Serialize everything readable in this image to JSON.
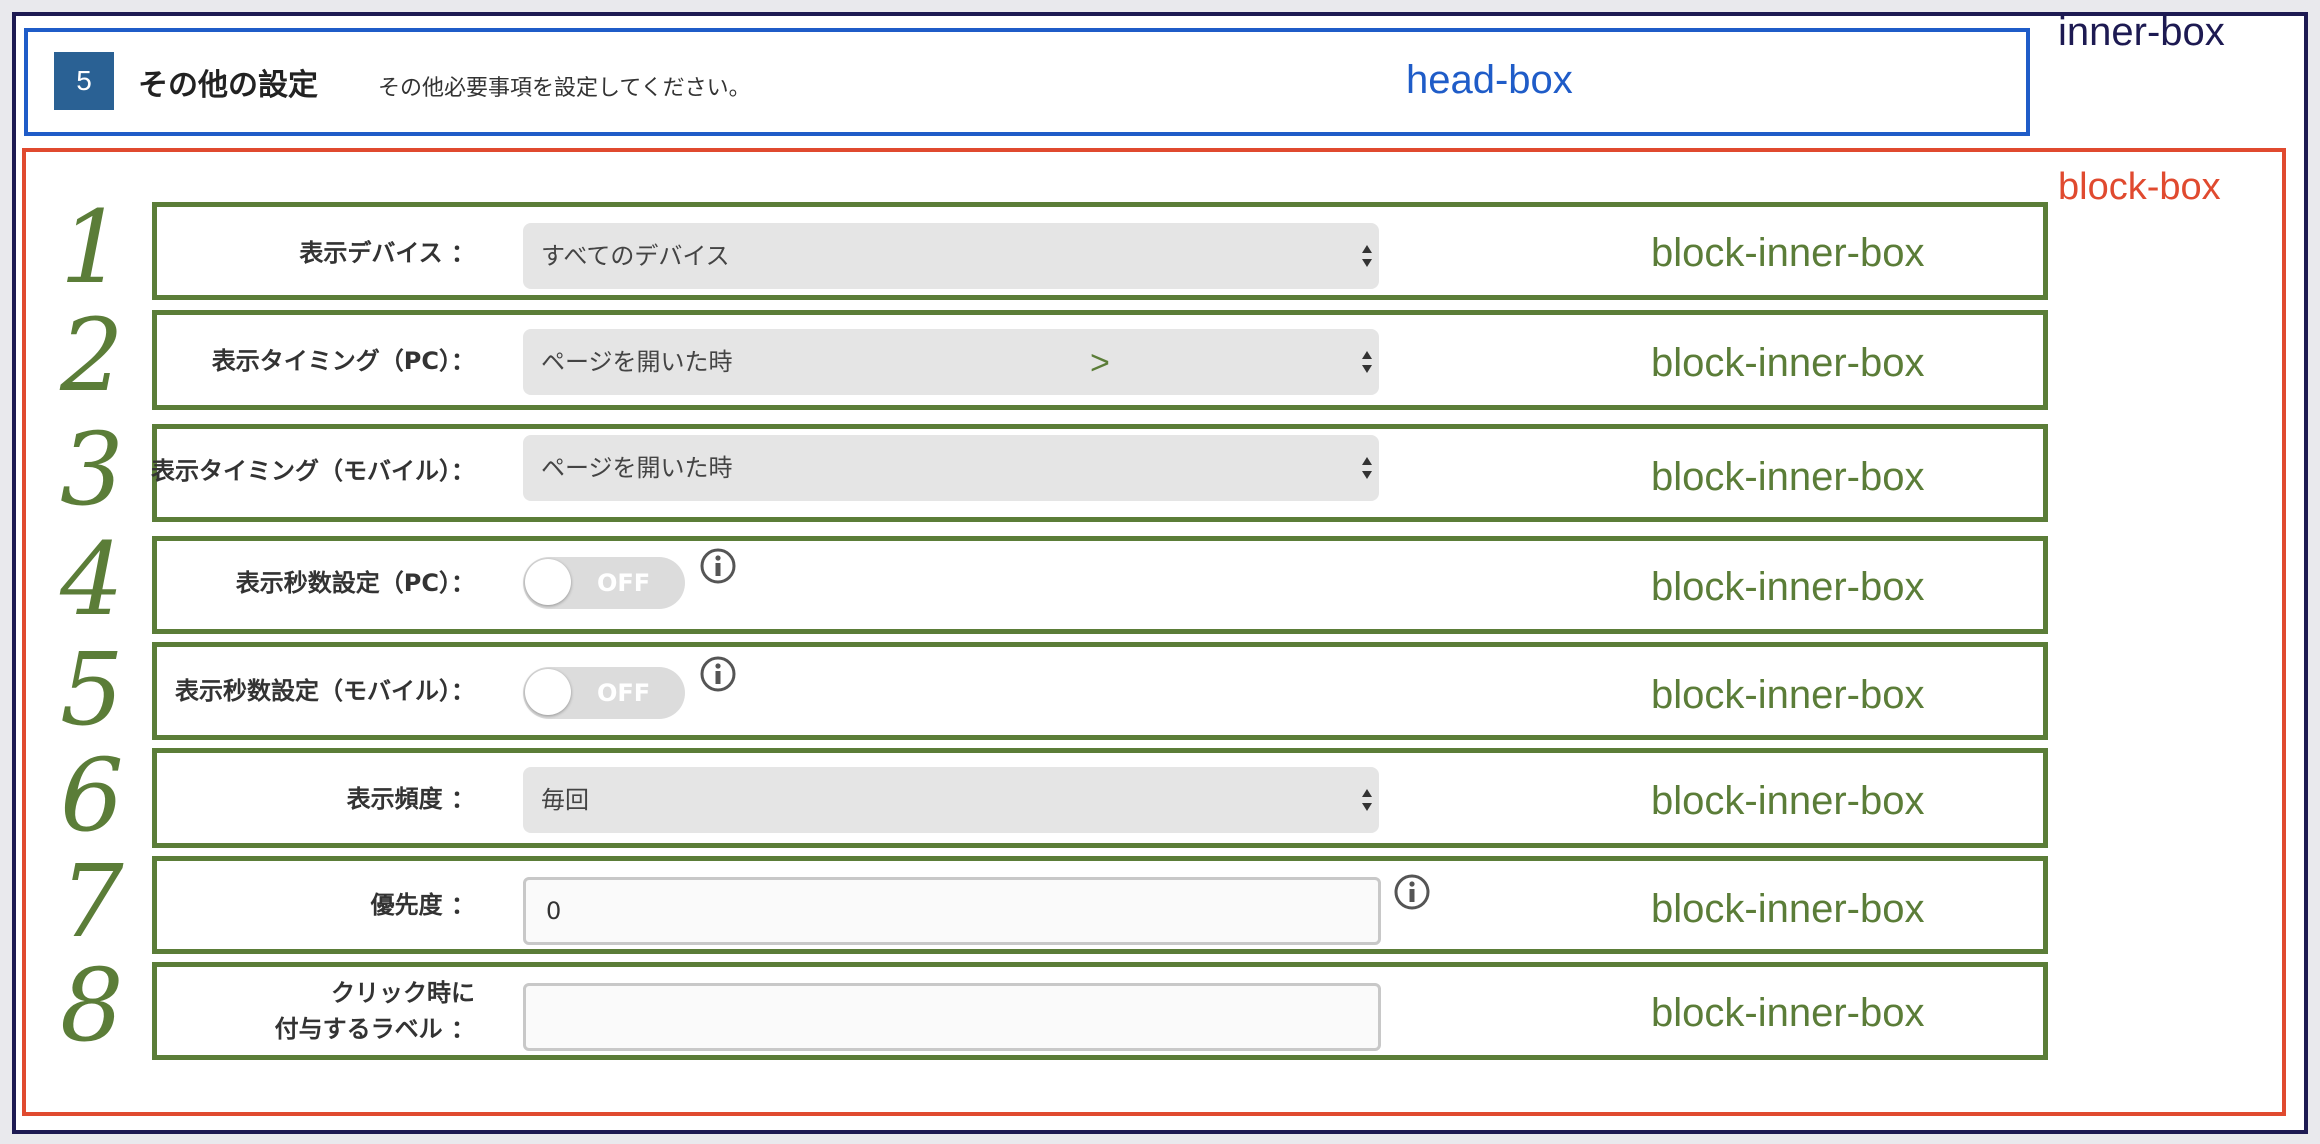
{
  "labels": {
    "inner_box": "inner-box",
    "head_box": "head-box",
    "block_box": "block-box",
    "block_inner_box": "block-inner-box"
  },
  "section": {
    "number": "5",
    "title": "その他の設定",
    "description": "その他必要事項を設定してください。"
  },
  "annotations": {
    "numbers": [
      "1",
      "2",
      "3",
      "4",
      "5",
      "6",
      "7",
      "8"
    ],
    "gt_mark": ">"
  },
  "rows": [
    {
      "label": "表示デバイス ：",
      "type": "select",
      "value": "すべてのデバイス"
    },
    {
      "label": "表示タイミング（PC）：",
      "type": "select",
      "value": "ページを開いた時"
    },
    {
      "label": "表示タイミング（モバイル）：",
      "type": "select",
      "value": "ページを開いた時"
    },
    {
      "label": "表示秒数設定（PC）：",
      "type": "toggle",
      "value": "OFF",
      "icon": "info-icon"
    },
    {
      "label": "表示秒数設定（モバイル）：",
      "type": "toggle",
      "value": "OFF",
      "icon": "info-icon"
    },
    {
      "label": "表示頻度 ：",
      "type": "select",
      "value": "毎回"
    },
    {
      "label": "優先度 ：",
      "type": "text",
      "value": "0",
      "icon": "info-icon"
    },
    {
      "label_line1": "クリック時に",
      "label_line2": "付与するラベル ：",
      "type": "text",
      "value": ""
    }
  ],
  "colors": {
    "inner_box": "#1d1a52",
    "head_box": "#1f5cc8",
    "block_box": "#e04a2f",
    "block_inner_box": "#5b7d38",
    "badge": "#2a6194"
  }
}
